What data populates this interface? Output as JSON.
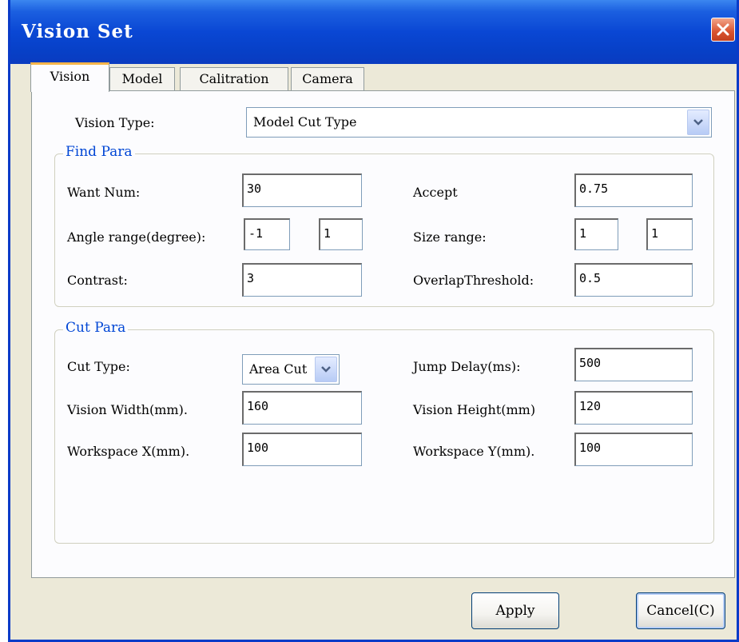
{
  "window": {
    "title": "Vision Set"
  },
  "tabs": [
    {
      "label": "Vision"
    },
    {
      "label": "Model"
    },
    {
      "label": "Calitration"
    },
    {
      "label": "Camera"
    }
  ],
  "vision_type": {
    "label": "Vision Type:",
    "value": "Model Cut Type"
  },
  "find_para": {
    "title": "Find Para",
    "want_num": {
      "label": "Want Num:",
      "value": "30"
    },
    "accept": {
      "label": "Accept",
      "value": "0.75"
    },
    "angle_range": {
      "label": "Angle range(degree):",
      "min": "-1",
      "max": "1"
    },
    "size_range": {
      "label": "Size range:",
      "min": "1",
      "max": "1"
    },
    "contrast": {
      "label": "Contrast:",
      "value": "3"
    },
    "overlap_threshold": {
      "label": "OverlapThreshold:",
      "value": "0.5"
    }
  },
  "cut_para": {
    "title": "Cut Para",
    "cut_type": {
      "label": "Cut Type:",
      "value": "Area Cut"
    },
    "jump_delay": {
      "label": "Jump Delay(ms):",
      "value": "500"
    },
    "vision_width": {
      "label": "Vision Width(mm).",
      "value": "160"
    },
    "vision_height": {
      "label": "Vision Height(mm)",
      "value": "120"
    },
    "workspace_x": {
      "label": "Workspace X(mm).",
      "value": "100"
    },
    "workspace_y": {
      "label": "Workspace Y(mm).",
      "value": "100"
    }
  },
  "buttons": {
    "apply": "Apply",
    "cancel": "Cancel(C)"
  },
  "colors": {
    "titlebar": "#0a47d4",
    "group_title": "#0046d5",
    "active_tab_accent": "#f5b54a",
    "close_button": "#d9532f"
  }
}
